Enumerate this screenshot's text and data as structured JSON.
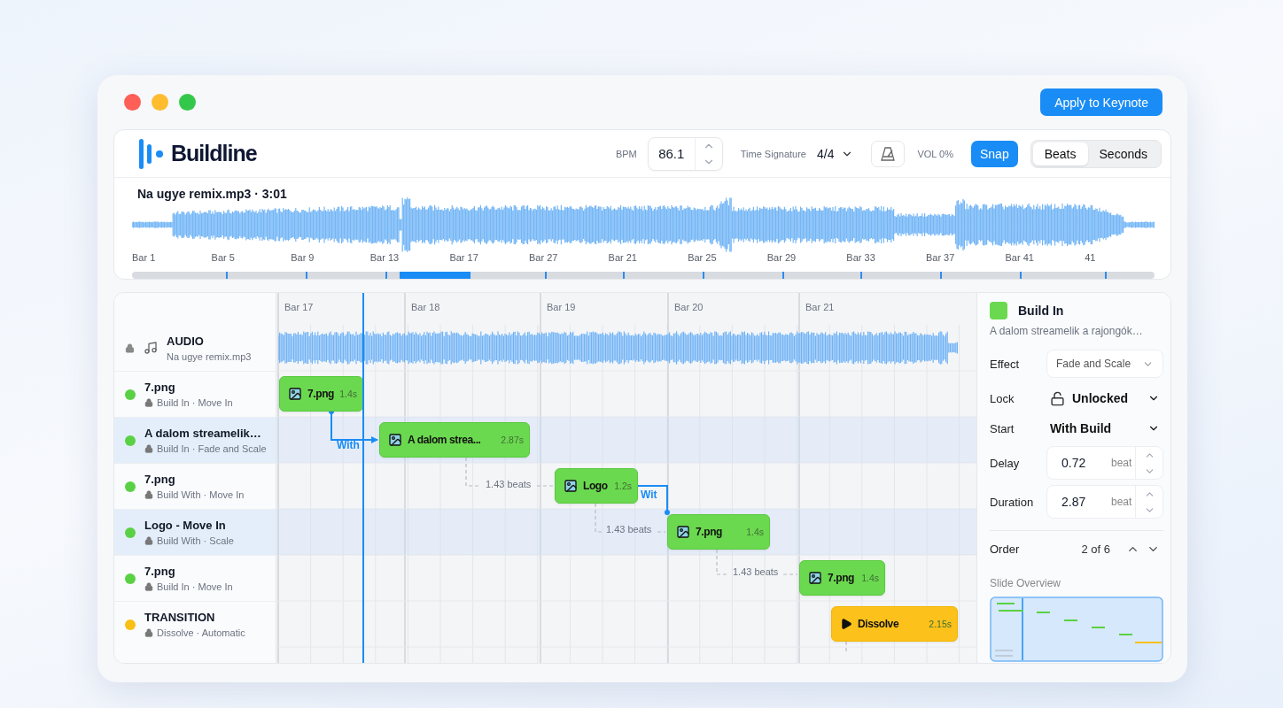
{
  "window": {
    "apply_button": "Apply to Keynote"
  },
  "header": {
    "app_name": "Buildline",
    "bpm_label": "BPM",
    "bpm_value": "86.1",
    "time_signature_label": "Time Signature",
    "time_signature": "4/4",
    "volume": "VOL 0%",
    "snap": {
      "label": "Snap",
      "on": true
    },
    "units": [
      {
        "label": "Beats",
        "selected": true
      },
      {
        "label": "Seconds",
        "selected": false
      }
    ]
  },
  "overview": {
    "title": "Na ugye remix.mp3 · 3:01",
    "bar_labels": [
      "Bar 1",
      "Bar 5",
      "Bar 9",
      "Bar 13",
      "Bar 17",
      "Bar 27",
      "Bar 21",
      "Bar 25",
      "Bar 29",
      "Bar 33",
      "Bar 37",
      "Bar 41",
      "41"
    ]
  },
  "timeline": {
    "bar_labels": [
      "Bar 17",
      "Bar 18",
      "Bar 19",
      "Bar 20",
      "Bar 21"
    ],
    "audio": {
      "title": "AUDIO",
      "file": "Na ugye remix.mp3"
    },
    "tracks": [
      {
        "name": "7.png",
        "detail": "Build In · Move In",
        "color": "#5ad145",
        "selected": false
      },
      {
        "name": "A dalom streamelik…",
        "detail": "Build In · Fade and Scale",
        "color": "#5ad145",
        "selected": true
      },
      {
        "name": "7.png",
        "detail": "Build With · Move In",
        "color": "#5ad145",
        "selected": false
      },
      {
        "name": "Logo - Move In",
        "detail": "Build With · Scale",
        "color": "#5ad145",
        "selected": true
      },
      {
        "name": "7.png",
        "detail": "Build In · Move In",
        "color": "#5ad145",
        "selected": false
      },
      {
        "name": "TRANSITION",
        "detail": "Dissolve · Automatic",
        "color": "#f8bf16",
        "selected": false
      }
    ],
    "clips": [
      {
        "kind": "image",
        "label": "7.png",
        "duration": "1.4s"
      },
      {
        "kind": "image",
        "label": "A dalom strea...",
        "duration": "2.87s"
      },
      {
        "kind": "image",
        "label": "Logo",
        "duration": "1.2s"
      },
      {
        "kind": "image",
        "label": "7.png",
        "duration": "1.4s"
      },
      {
        "kind": "image",
        "label": "7.png",
        "duration": "1.4s"
      },
      {
        "kind": "transition",
        "label": "Dissolve",
        "duration": "2.15s"
      }
    ],
    "links": [
      {
        "kind": "with",
        "label": "With"
      },
      {
        "kind": "gap",
        "label": "1.43 beats"
      },
      {
        "kind": "with",
        "label": "Wit"
      },
      {
        "kind": "gap",
        "label": "1.43 beats"
      },
      {
        "kind": "gap",
        "label": "1.43 beats"
      }
    ]
  },
  "inspector": {
    "title": "Build In",
    "subtitle": "A dalom streamelik a rajongók…",
    "fields": [
      {
        "kind": "select",
        "label": "Effect",
        "value": "Fade and Scale"
      },
      {
        "kind": "lock",
        "label": "Lock",
        "value": "Unlocked"
      },
      {
        "kind": "dropdown",
        "label": "Start",
        "value": "With Build"
      },
      {
        "kind": "stepper",
        "label": "Delay",
        "value": "0.72",
        "unit": "beat"
      },
      {
        "kind": "stepper",
        "label": "Duration",
        "value": "2.87",
        "unit": "beat"
      }
    ],
    "order": {
      "label": "Order",
      "value": "2 of 6"
    },
    "overview_title": "Slide Overview"
  }
}
